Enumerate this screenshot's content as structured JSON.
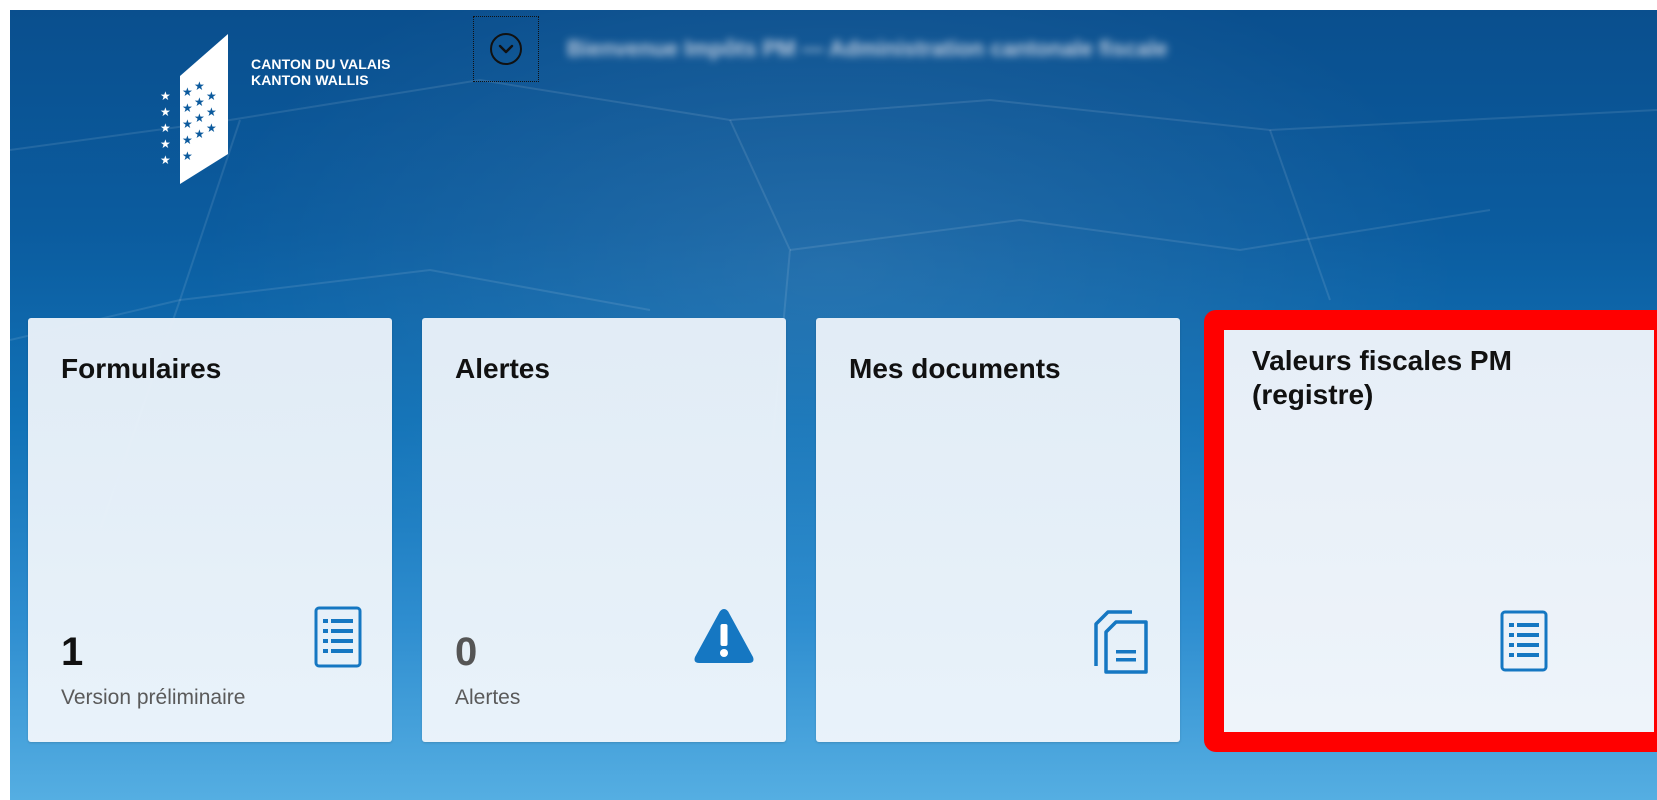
{
  "header": {
    "logo": {
      "line1": "CANTON DU VALAIS",
      "line2": "KANTON WALLIS"
    },
    "toggle_icon": "chevron-down-circle-icon",
    "blurred_title": "Bienvenue Impôts PM — Administration cantonale fiscale"
  },
  "tiles": [
    {
      "title": "Formulaires",
      "number": "1",
      "caption": "Version préliminaire",
      "icon": "form-list-icon"
    },
    {
      "title": "Alertes",
      "number": "0",
      "caption": "Alertes",
      "icon": "warning-icon"
    },
    {
      "title": "Mes documents",
      "icon": "documents-icon"
    },
    {
      "title_line1": "Valeurs fiscales PM",
      "title_line2": "(registre)",
      "icon": "form-list-icon"
    }
  ],
  "colors": {
    "accent_blue": "#1577c2",
    "highlight_red": "#ff0000",
    "background_top": "#0a4f8e",
    "background_bottom": "#55aee2"
  }
}
